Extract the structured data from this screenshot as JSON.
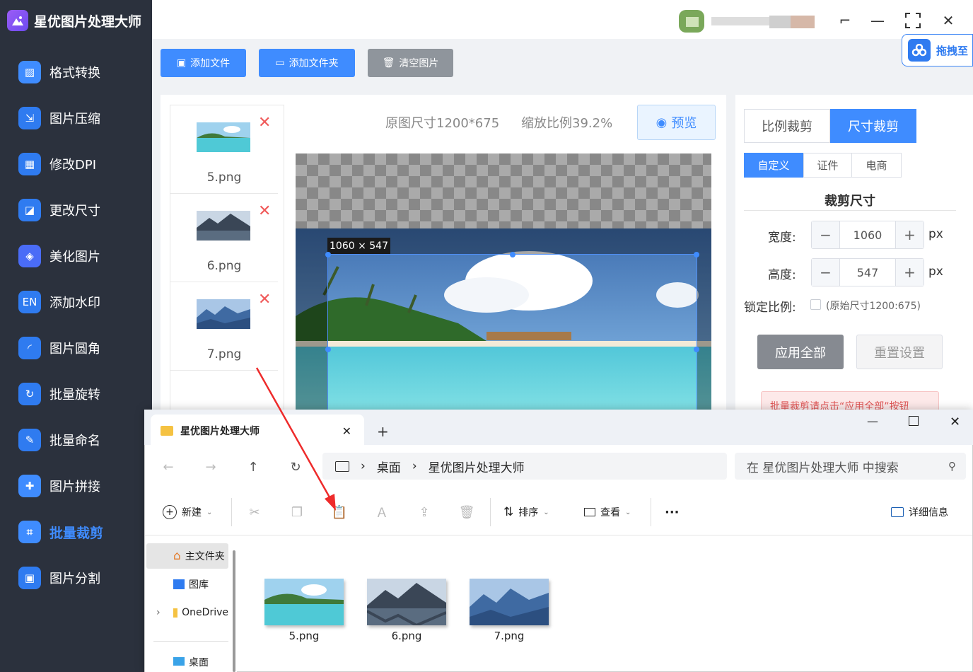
{
  "app": {
    "title": "星优图片处理大师"
  },
  "sidebar": {
    "items": [
      {
        "label": "格式转换",
        "icon": "image-convert-icon"
      },
      {
        "label": "图片压缩",
        "icon": "compress-icon"
      },
      {
        "label": "修改DPI",
        "icon": "dpi-icon"
      },
      {
        "label": "更改尺寸",
        "icon": "resize-icon"
      },
      {
        "label": "美化图片",
        "icon": "beautify-icon"
      },
      {
        "label": "添加水印",
        "icon": "watermark-icon"
      },
      {
        "label": "图片圆角",
        "icon": "rounded-corner-icon"
      },
      {
        "label": "批量旋转",
        "icon": "rotate-icon"
      },
      {
        "label": "批量命名",
        "icon": "rename-icon"
      },
      {
        "label": "图片拼接",
        "icon": "puzzle-icon"
      },
      {
        "label": "批量裁剪",
        "icon": "crop-icon",
        "active": true
      },
      {
        "label": "图片分割",
        "icon": "split-icon"
      }
    ]
  },
  "toolbar": {
    "add_file": "添加文件",
    "add_folder": "添加文件夹",
    "clear": "清空图片",
    "drag_cloud": "拖拽至"
  },
  "files": [
    {
      "name": "5.png"
    },
    {
      "name": "6.png"
    },
    {
      "name": "7.png"
    }
  ],
  "preview": {
    "original_size": "原图尺寸1200*675",
    "scale": "缩放比例39.2%",
    "button": "预览",
    "crop_label": "1060 × 547"
  },
  "crop_panel": {
    "mode_tabs": [
      "比例裁剪",
      "尺寸裁剪"
    ],
    "active_mode": "尺寸裁剪",
    "sub_tabs": [
      "自定义",
      "证件",
      "电商"
    ],
    "active_sub": "自定义",
    "section_title": "裁剪尺寸",
    "width_label": "宽度:",
    "width_value": "1060",
    "height_label": "高度:",
    "height_value": "547",
    "unit": "px",
    "lock_label": "锁定比例:",
    "lock_hint": "(原始尺寸1200:675)",
    "apply_all": "应用全部",
    "reset": "重置设置",
    "batch_hint": "批量裁剪请点击“应用全部”按钮"
  },
  "explorer": {
    "tab_title": "星优图片处理大师",
    "breadcrumb": [
      "桌面",
      "星优图片处理大师"
    ],
    "search_placeholder": "在 星优图片处理大师 中搜索",
    "commands": {
      "new": "新建",
      "sort": "排序",
      "view": "查看",
      "more": "···",
      "details": "详细信息"
    },
    "tree": [
      "主文件夹",
      "图库",
      "OneDrive",
      "桌面"
    ],
    "files": [
      "5.png",
      "6.png",
      "7.png"
    ]
  },
  "colors": {
    "sidebar_bg": "#2b313d",
    "primary": "#3f8cff",
    "danger": "#f05a5a"
  }
}
